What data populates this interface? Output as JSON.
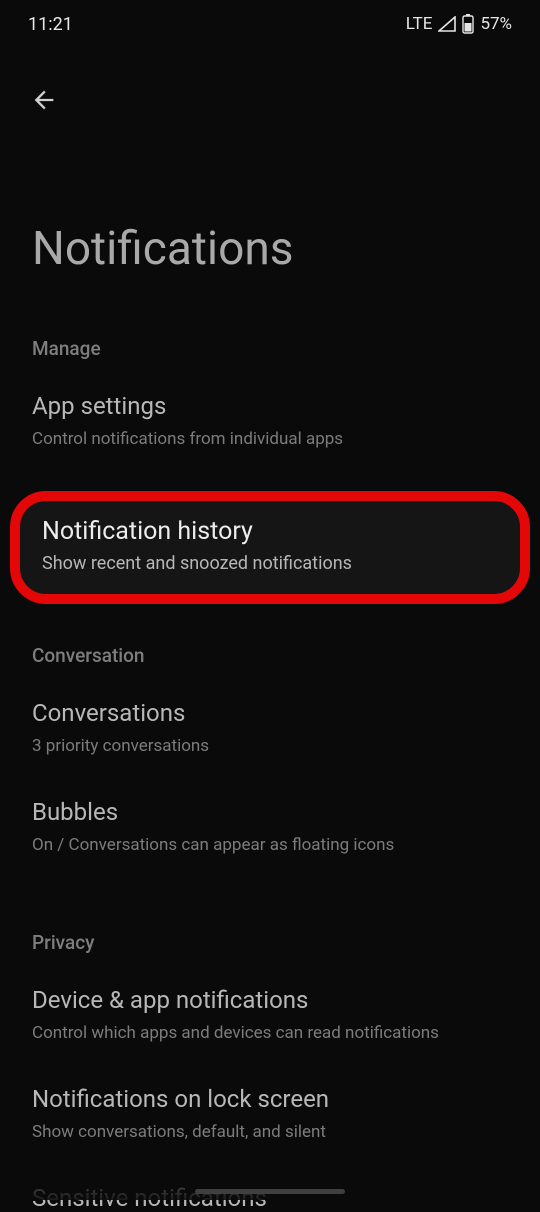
{
  "status": {
    "time": "11:21",
    "network": "LTE",
    "battery": "57%"
  },
  "page": {
    "title": "Notifications"
  },
  "sections": {
    "manage": {
      "label": "Manage",
      "app_settings": {
        "title": "App settings",
        "sub": "Control notifications from individual apps"
      },
      "history": {
        "title": "Notification history",
        "sub": "Show recent and snoozed notifications"
      }
    },
    "conversation": {
      "label": "Conversation",
      "conversations": {
        "title": "Conversations",
        "sub": "3 priority conversations"
      },
      "bubbles": {
        "title": "Bubbles",
        "sub": "On / Conversations can appear as floating icons"
      }
    },
    "privacy": {
      "label": "Privacy",
      "device_app": {
        "title": "Device & app notifications",
        "sub": "Control which apps and devices can read notifications"
      },
      "lockscreen": {
        "title": "Notifications on lock screen",
        "sub": "Show conversations, default, and silent"
      },
      "sensitive": {
        "title": "Sensitive notifications"
      }
    }
  }
}
